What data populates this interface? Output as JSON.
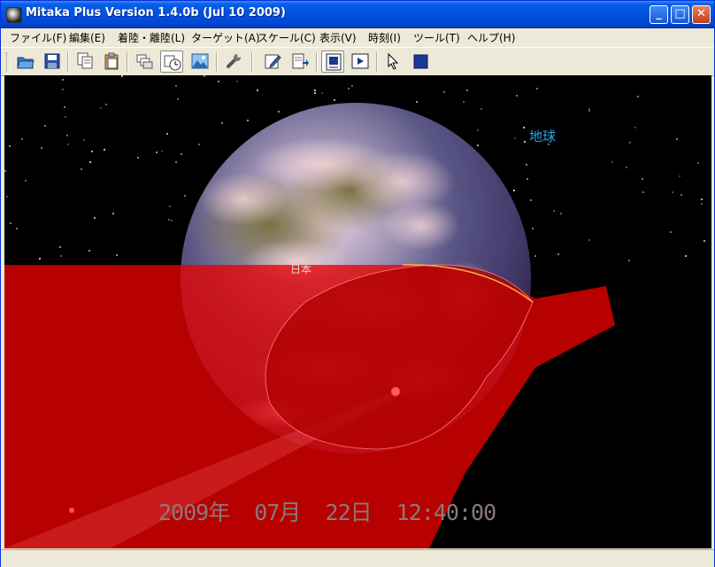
{
  "window": {
    "title": "Mitaka Plus Version 1.4.0b (Jul 10 2009)"
  },
  "window_buttons": {
    "minimize": "_",
    "maximize": "□",
    "close": "✕"
  },
  "menu": [
    {
      "label": "ファイル(F)"
    },
    {
      "label": "編集(E)"
    },
    {
      "label": "着陸・離陸(L)"
    },
    {
      "label": "ターゲット(A)"
    },
    {
      "label": "スケール(C)"
    },
    {
      "label": "表示(V)"
    },
    {
      "label": "時刻(I)"
    },
    {
      "label": "ツール(T)"
    },
    {
      "label": "ヘルプ(H)"
    }
  ],
  "toolbar_icons": [
    "open-folder-icon",
    "save-icon",
    "copy-icon",
    "paste-icon",
    "layers-icon",
    "clock-settings-icon",
    "landscape-icon",
    "wrench-icon",
    "edit-icon",
    "export-icon",
    "view-mode-icon",
    "movie-icon",
    "pointer-icon",
    "stop-icon"
  ],
  "scene": {
    "planet_label": "地球",
    "region_label": "日本",
    "datetime": "2009年  07月  22日  12:40:00",
    "colors": {
      "space": "#000000",
      "shadow_cone": "#e00000",
      "label_planet": "#2aa6e0",
      "label_datetime": "#8a7a7a"
    }
  }
}
